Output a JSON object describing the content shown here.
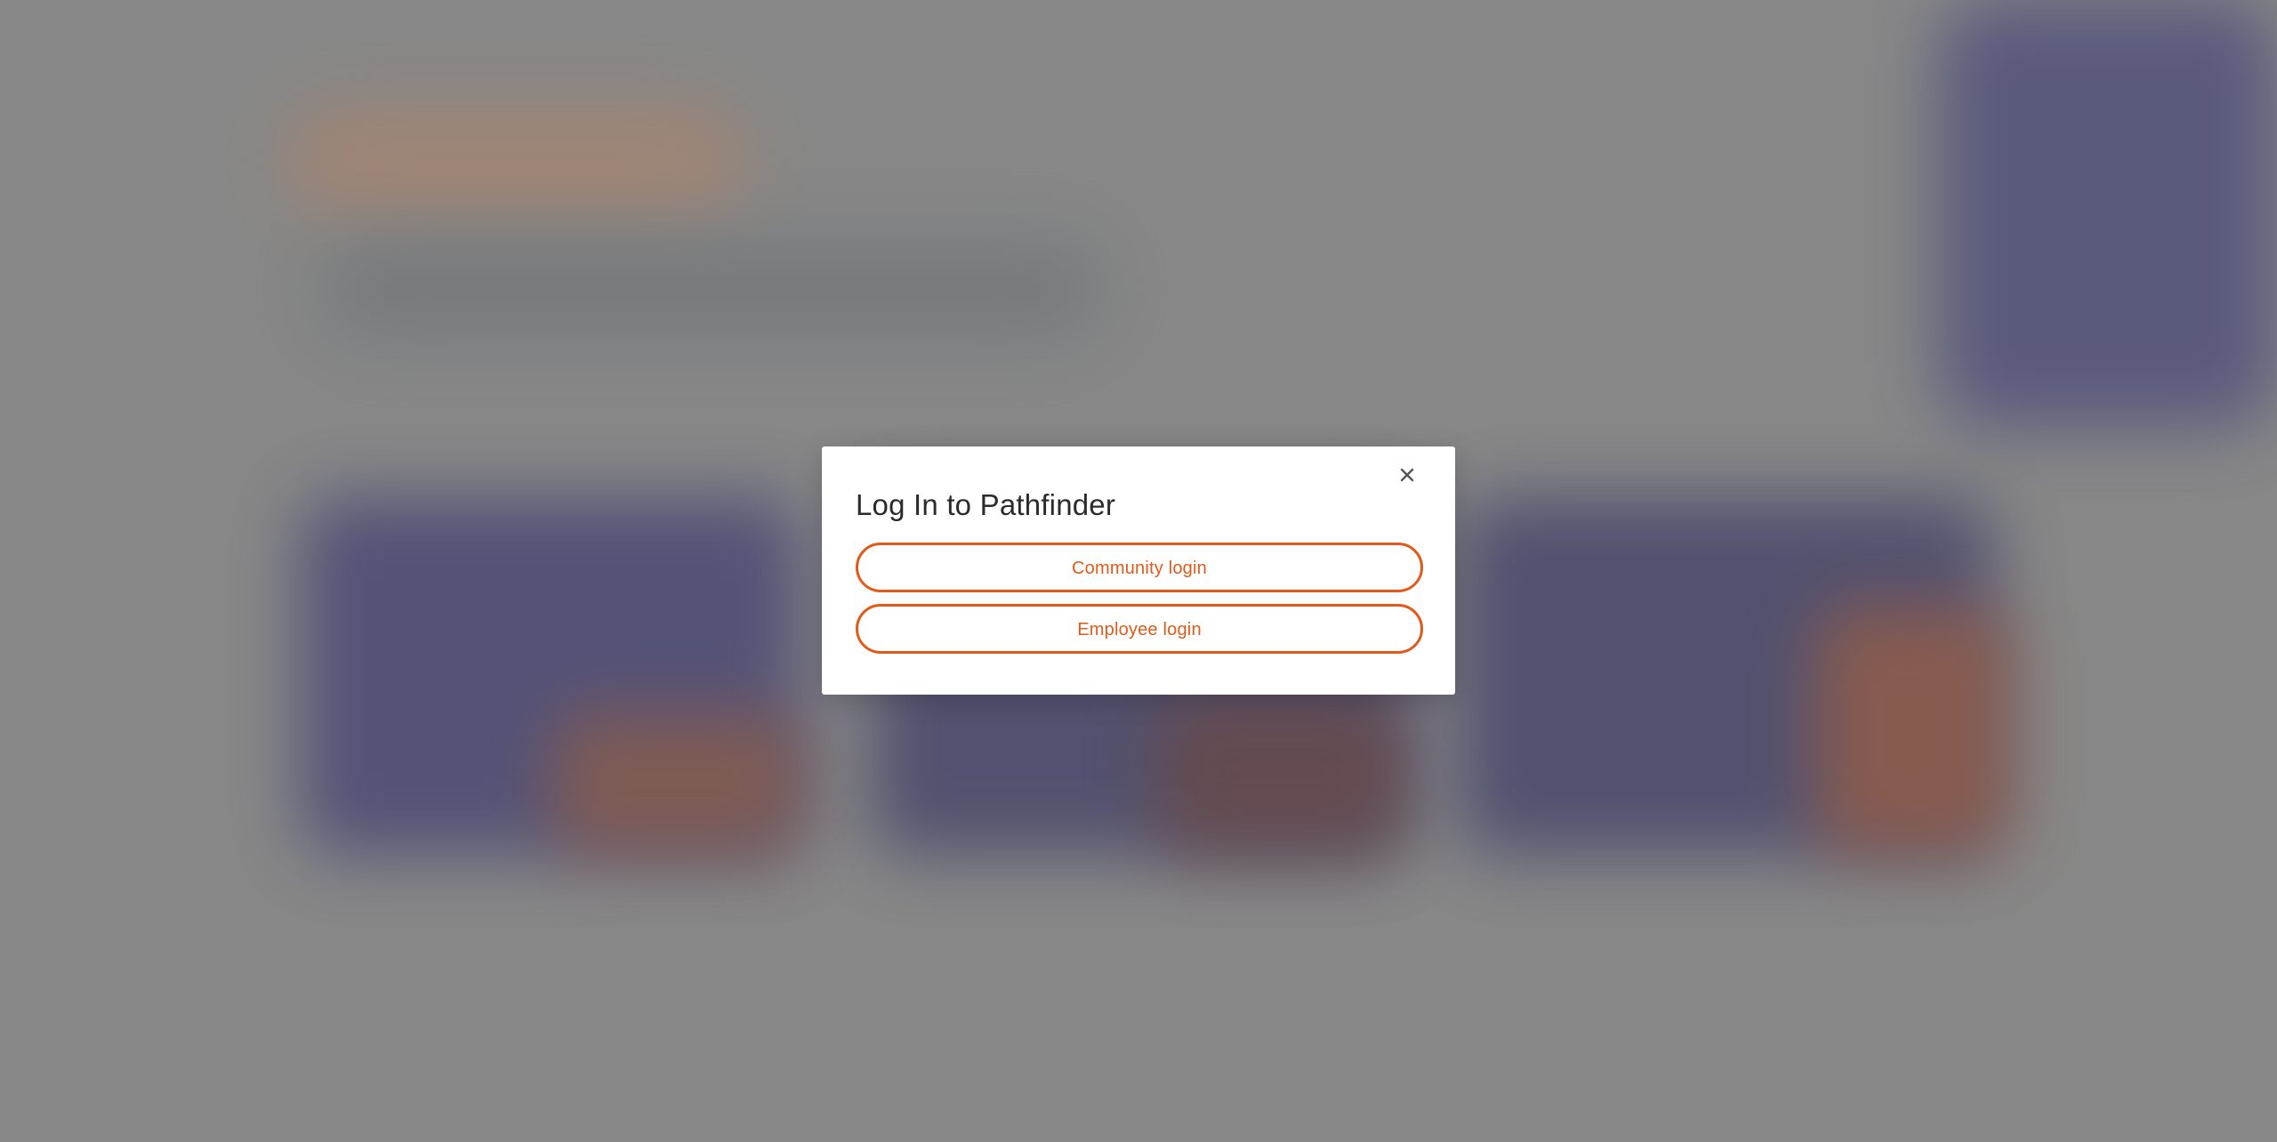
{
  "modal": {
    "title": "Log In to Pathfinder",
    "close_label": "×",
    "buttons": [
      {
        "label": "Community login"
      },
      {
        "label": "Employee login"
      }
    ]
  },
  "colors": {
    "accent": "#e25a19",
    "title": "#2b2b2b",
    "overlay": "#808080",
    "modal_bg": "#ffffff"
  },
  "icons": {
    "close": "close-icon"
  }
}
